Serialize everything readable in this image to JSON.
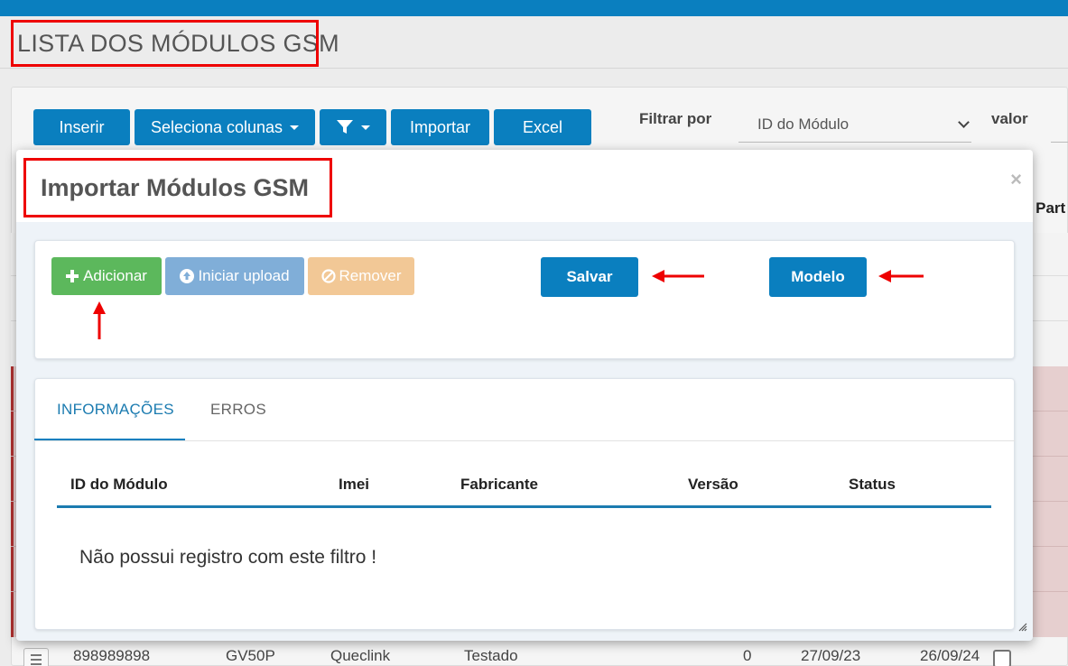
{
  "page": {
    "title": "LISTA DOS MÓDULOS GSM"
  },
  "toolbar": {
    "insert": "Inserir",
    "select_columns": "Seleciona colunas",
    "import": "Importar",
    "excel": "Excel",
    "filter_by_label": "Filtrar por",
    "filter_by_value": "ID do Módulo",
    "value_label": "valor"
  },
  "background_table": {
    "partial_header": "o Part",
    "visible_row": {
      "id": "898989898",
      "model": "GV50P",
      "manufacturer": "Queclink",
      "status": "Testado",
      "count": "0",
      "date1": "27/09/23",
      "date2": "26/09/24"
    }
  },
  "modal": {
    "title": "Importar Módulos GSM",
    "close": "×",
    "buttons": {
      "add": "Adicionar",
      "start_upload": "Iniciar upload",
      "remove": "Remover",
      "save": "Salvar",
      "template": "Modelo"
    },
    "tabs": [
      "INFORMAÇÕES",
      "ERROS"
    ],
    "active_tab": "INFORMAÇÕES",
    "columns": [
      "ID do Módulo",
      "Imei",
      "Fabricante",
      "Versão",
      "Status"
    ],
    "empty_message": "Não possui registro com este filtro !"
  },
  "colors": {
    "primary": "#0a7fbf",
    "success": "#5cb85c",
    "info_disabled": "#80aed8",
    "warning_disabled": "#f2c896",
    "highlight": "#ee0000"
  }
}
